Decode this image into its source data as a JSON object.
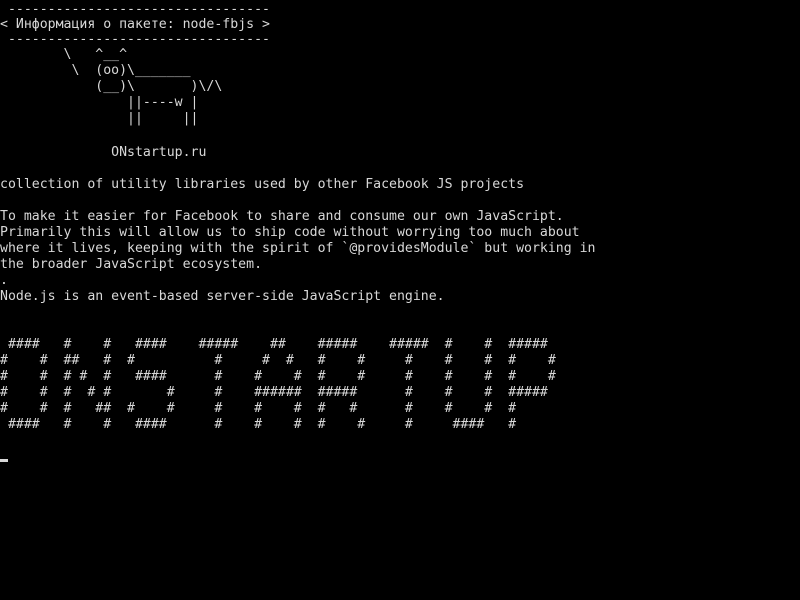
{
  "terminal": {
    "banner": {
      "top_rule": " ---------------------------------",
      "title": "< Информация о пакете: node-fbjs >",
      "bottom_rule": " ---------------------------------"
    },
    "cow": [
      "        \\   ^__^",
      "         \\  (oo)\\_______",
      "            (__)\\       )\\/\\",
      "                ||----w |",
      "                ||     ||"
    ],
    "site": "              ONstartup.ru",
    "summary": "collection of utility libraries used by other Facebook JS projects",
    "description": [
      "To make it easier for Facebook to share and consume our own JavaScript.",
      "Primarily this will allow us to ship code without worrying too much about",
      "where it lives, keeping with the spirit of `@providesModule` but working in",
      "the broader JavaScript ecosystem."
    ],
    "dot": ".",
    "node_line": "Node.js is an event-based server-side JavaScript engine.",
    "ascii_art": [
      " ####   #    #   ####    #####    ##    #####    #####  #    #  #####",
      "#    #  ##   #  #          #     #  #   #    #     #    #    #  #    #",
      "#    #  # #  #   ####      #    #    #  #    #     #    #    #  #    #",
      "#    #  #  # #       #     #    ######  #####      #    #    #  #####",
      "#    #  #   ##  #    #     #    #    #  #   #      #    #    #  #",
      " ####   #    #   ####      #    #    #  #    #     #     ####   #"
    ]
  }
}
